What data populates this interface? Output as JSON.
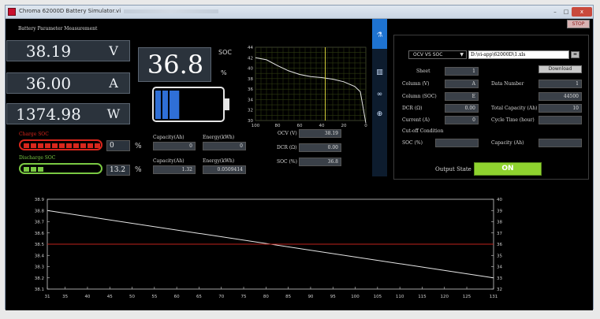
{
  "window": {
    "title": "Chroma 62000D Battery Simulator.vi",
    "min_label": "–",
    "max_label": "□",
    "close_label": "x"
  },
  "stop_button": "STOP",
  "measurement": {
    "title": "Battery Parameter Measurement",
    "voltage": {
      "value": "38.19",
      "unit": "V"
    },
    "current": {
      "value": "36.00",
      "unit": "A"
    },
    "power": {
      "value": "1374.98",
      "unit": "W"
    },
    "soc": {
      "value": "36.8",
      "label": "SOC",
      "unit": "%",
      "fill_fraction": 0.37
    }
  },
  "charge": {
    "label": "Charge SOC",
    "percent": "0",
    "unit": "%",
    "capacity_label": "Capacity(Ah)",
    "capacity_value": "0",
    "energy_label": "Energy(kWh)",
    "energy_value": "0",
    "bar_color": "#d9261c",
    "filled_segments": 11
  },
  "discharge": {
    "label": "Discharge SOC",
    "percent": "13.2",
    "unit": "%",
    "capacity_label": "Capacity(Ah)",
    "capacity_value": "1.32",
    "energy_label": "Energy(kWh)",
    "energy_value": "0.0509414",
    "bar_color": "#7ac843",
    "filled_segments": 3
  },
  "readouts": {
    "ocv": {
      "label": "OCV (V)",
      "value": "38.19"
    },
    "dcr": {
      "label": "DCR (Ω)",
      "value": "0.00"
    },
    "soc": {
      "label": "SOC (%)",
      "value": "36.8"
    }
  },
  "sidebar": {
    "icons": [
      "flask-icon",
      "table-icon",
      "link-icon",
      "globe-icon"
    ]
  },
  "config": {
    "mode_select": "OCV VS SOC",
    "file_path": "D:\\vi-app\\62000D\\1.xls",
    "download_label": "Download",
    "sheet": {
      "label": "Sheet",
      "value": "1"
    },
    "col_v": {
      "label": "Column (V)",
      "value": "A"
    },
    "col_soc": {
      "label": "Column (SOC)",
      "value": "E"
    },
    "dcr": {
      "label": "DCR (Ω)",
      "value": "0.00"
    },
    "current": {
      "label": "Current (A)",
      "value": "0"
    },
    "data_number": {
      "label": "Data Number",
      "value": "1"
    },
    "data_number2": {
      "value": "44500"
    },
    "total_capacity": {
      "label": "Total Capacity (Ah)",
      "value": "10"
    },
    "cycle_time": {
      "label": "Cycle Time (hour)",
      "value": ""
    },
    "cutoff_title": "Cut-off Condition",
    "cutoff_soc": {
      "label": "SOC (%)",
      "value": ""
    },
    "cutoff_capacity": {
      "label": "Capacity (Ah)",
      "value": ""
    }
  },
  "output_state": {
    "label": "Output State",
    "value": "ON"
  },
  "colors": {
    "accent": "#1e73d1",
    "on": "#8fd32f",
    "plot_line_white": "#e8e8e8",
    "plot_line_red": "#c0221b",
    "cursor": "#d6d23a"
  },
  "chart_data": [
    {
      "type": "line",
      "title": "",
      "x": [
        100,
        90,
        80,
        70,
        60,
        50,
        40,
        30,
        20,
        10,
        5,
        0
      ],
      "series": [
        {
          "values": [
            42,
            41.6,
            40.5,
            39.5,
            38.8,
            38.4,
            38.2,
            37.9,
            37.4,
            36.5,
            35.5,
            29.5
          ]
        }
      ],
      "xlim": [
        100,
        0
      ],
      "ylim": [
        30,
        44
      ],
      "x_ticks": [
        "100",
        "80",
        "60",
        "40",
        "20",
        "0"
      ],
      "y_ticks": [
        "30",
        "32",
        "34",
        "36",
        "38",
        "40",
        "42",
        "44"
      ],
      "cursor_x": 36.8,
      "grid": true
    },
    {
      "type": "line",
      "title": "",
      "x": [
        31,
        131
      ],
      "series": [
        {
          "values": [
            38.8,
            38.2
          ],
          "axis": "left"
        },
        {
          "values": [
            36,
            36
          ],
          "axis": "right"
        }
      ],
      "xlim": [
        31,
        131
      ],
      "ylim_left": [
        38.1,
        38.9
      ],
      "ylim_right": [
        32,
        40
      ],
      "x_ticks": [
        "31",
        "35",
        "40",
        "45",
        "50",
        "55",
        "60",
        "65",
        "70",
        "75",
        "80",
        "85",
        "90",
        "95",
        "100",
        "105",
        "110",
        "115",
        "120",
        "125",
        "131"
      ],
      "y_ticks_left": [
        "38.1",
        "38.2",
        "38.3",
        "38.4",
        "38.5",
        "38.6",
        "38.7",
        "38.8",
        "38.9"
      ],
      "y_ticks_right": [
        "32",
        "33",
        "34",
        "35",
        "36",
        "37",
        "38",
        "39",
        "40"
      ],
      "grid": false
    }
  ]
}
